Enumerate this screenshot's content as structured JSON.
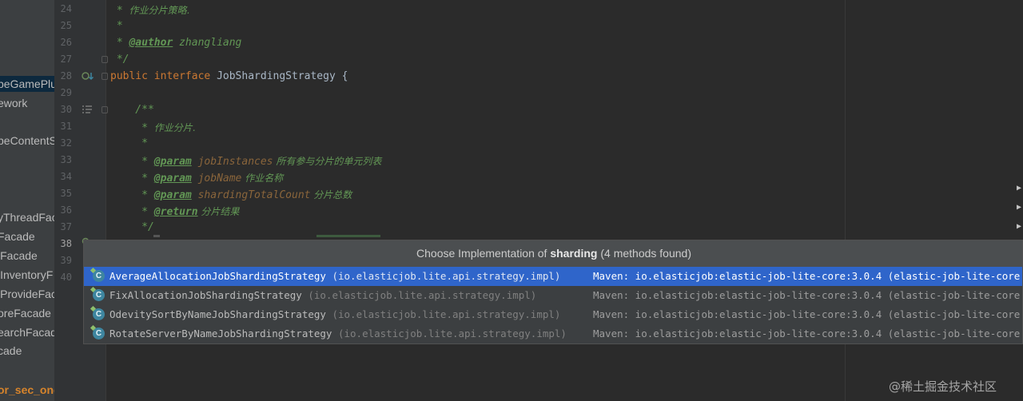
{
  "project_tree": {
    "items": [
      {
        "label": "peGamePlu",
        "selected": true
      },
      {
        "label": "ework"
      },
      {
        "label": "peContentS"
      },
      {
        "label": "yThreadFac"
      },
      {
        "label": "Facade"
      },
      {
        "label": "lFacade"
      },
      {
        "label": "lInventoryF"
      },
      {
        "label": "lProvideFac"
      },
      {
        "label": "oreFacade"
      },
      {
        "label": "earchFacad"
      },
      {
        "label": "cade"
      },
      {
        "label": "or_sec_one",
        "highlight": "orange"
      }
    ]
  },
  "editor": {
    "line_numbers": [
      "24",
      "25",
      "26",
      "27",
      "28",
      "29",
      "30",
      "31",
      "32",
      "33",
      "34",
      "35",
      "36",
      "37",
      "38",
      "39",
      "40"
    ],
    "active_line": "38",
    "code": {
      "l24": {
        "star": " * ",
        "text": "作业分片策略."
      },
      "l25": " *",
      "l26": {
        "star": " * ",
        "tag": "@author",
        "text": " zhangliang"
      },
      "l27": " */",
      "l28": {
        "kw1": "public",
        "kw2": "interface",
        "name": "JobShardingStrategy {"
      },
      "l30": "    /**",
      "l31": {
        "star": "     * ",
        "text": "作业分片."
      },
      "l32": "     *",
      "l33": {
        "star": "     * ",
        "tag": "@param",
        "param": " jobInstances",
        "text": " 所有参与分片的单元列表"
      },
      "l34": {
        "star": "     * ",
        "tag": "@param",
        "param": " jobName",
        "text": " 作业名称"
      },
      "l35": {
        "star": "     * ",
        "tag": "@param",
        "param": " shardingTotalCount",
        "text": " 分片总数"
      },
      "l36": {
        "star": "     * ",
        "tag": "@return",
        "text": " 分片结果"
      },
      "l37": "     */"
    }
  },
  "popup": {
    "title_prefix": "Choose Implementation of ",
    "title_method": "sharding",
    "title_suffix": " (4 methods found)",
    "rows": [
      {
        "icon": "C",
        "name": "AverageAllocationJobShardingStrategy",
        "package": " (io.elasticjob.lite.api.strategy.impl)",
        "maven": "Maven: io.elasticjob:elastic-job-lite-core:3.0.4 (elastic-job-lite-core",
        "selected": true
      },
      {
        "icon": "C",
        "name": "FixAllocationJobShardingStrategy",
        "package": " (io.elasticjob.lite.api.strategy.impl)",
        "maven": "Maven: io.elasticjob:elastic-job-lite-core:3.0.4 (elastic-job-lite-core"
      },
      {
        "icon": "C",
        "name": "OdevitySortByNameJobShardingStrategy",
        "package": " (io.elasticjob.lite.api.strategy.impl)",
        "maven": "Maven: io.elasticjob:elastic-job-lite-core:3.0.4 (elastic-job-lite-core"
      },
      {
        "icon": "C",
        "name": "RotateServerByNameJobShardingStrategy",
        "package": " (io.elasticjob.lite.api.strategy.impl)",
        "maven": "Maven: io.elasticjob:elastic-job-lite-core:3.0.4 (elastic-job-lite-core"
      }
    ]
  },
  "right_arrows": [
    "▶",
    "▶",
    "▶"
  ],
  "watermark": "@稀土掘金技术社区",
  "colors": {
    "background": "#2b2b2b",
    "selection": "#2f65ca",
    "comment": "#629755",
    "keyword": "#cc7832"
  }
}
